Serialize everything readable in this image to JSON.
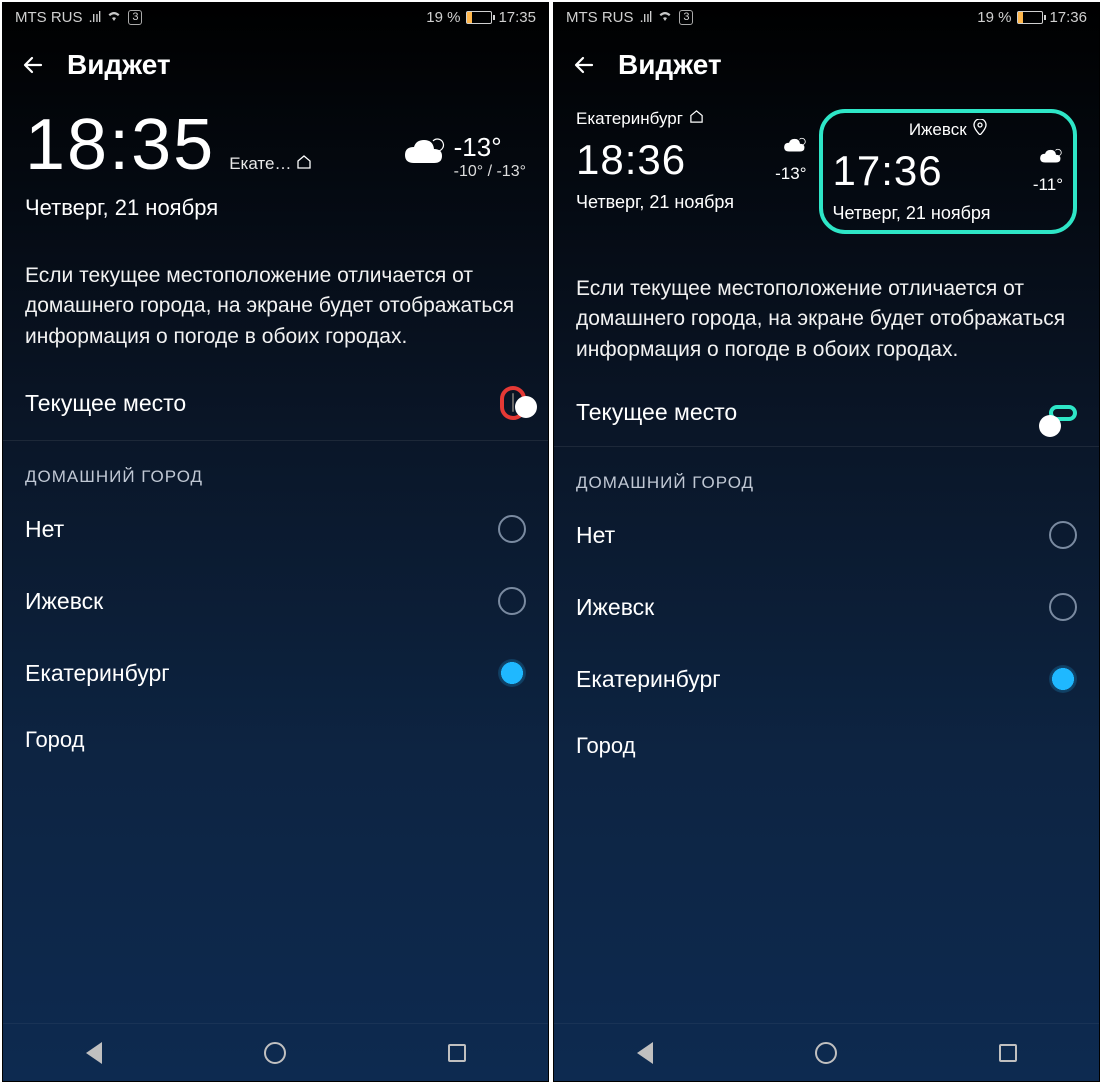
{
  "left": {
    "status": {
      "carrier": "MTS RUS",
      "battery_pct": "19 %",
      "time": "17:35",
      "sim": "3"
    },
    "header": {
      "title": "Виджет"
    },
    "preview": {
      "big_time": "18:35",
      "city_short": "Екате…",
      "temp_main": "-13°",
      "temp_range": "-10° / -13°",
      "date": "Четверг, 21 ноября"
    },
    "desc": "Если текущее местоположение отличается от домашнего города, на экране будет отображаться информация о погоде в обоих городах.",
    "toggle": {
      "label": "Текущее место",
      "on": false
    },
    "section_hdr": "ДОМАШНИЙ ГОРОД",
    "options": [
      {
        "label": "Нет",
        "selected": false
      },
      {
        "label": "Ижевск",
        "selected": false
      },
      {
        "label": "Екатеринбург",
        "selected": true
      }
    ],
    "city_label": "Город",
    "highlight_color": "#e53935"
  },
  "right": {
    "status": {
      "carrier": "MTS RUS",
      "battery_pct": "19 %",
      "time": "17:36",
      "sim": "3"
    },
    "header": {
      "title": "Виджет"
    },
    "preview": {
      "left_col": {
        "city": "Екатеринбург",
        "time": "18:36",
        "temp": "-13°",
        "date": "Четверг, 21 ноября"
      },
      "right_col": {
        "city": "Ижевск",
        "time": "17:36",
        "temp": "-11°",
        "date": "Четверг, 21 ноября"
      }
    },
    "desc": "Если текущее местоположение отличается от домашнего города, на экране будет отображаться информация о погоде в обоих городах.",
    "toggle": {
      "label": "Текущее место",
      "on": true
    },
    "section_hdr": "ДОМАШНИЙ ГОРОД",
    "options": [
      {
        "label": "Нет",
        "selected": false
      },
      {
        "label": "Ижевск",
        "selected": false
      },
      {
        "label": "Екатеринбург",
        "selected": true
      }
    ],
    "city_label": "Город",
    "highlight_color": "#2ee6c7"
  }
}
